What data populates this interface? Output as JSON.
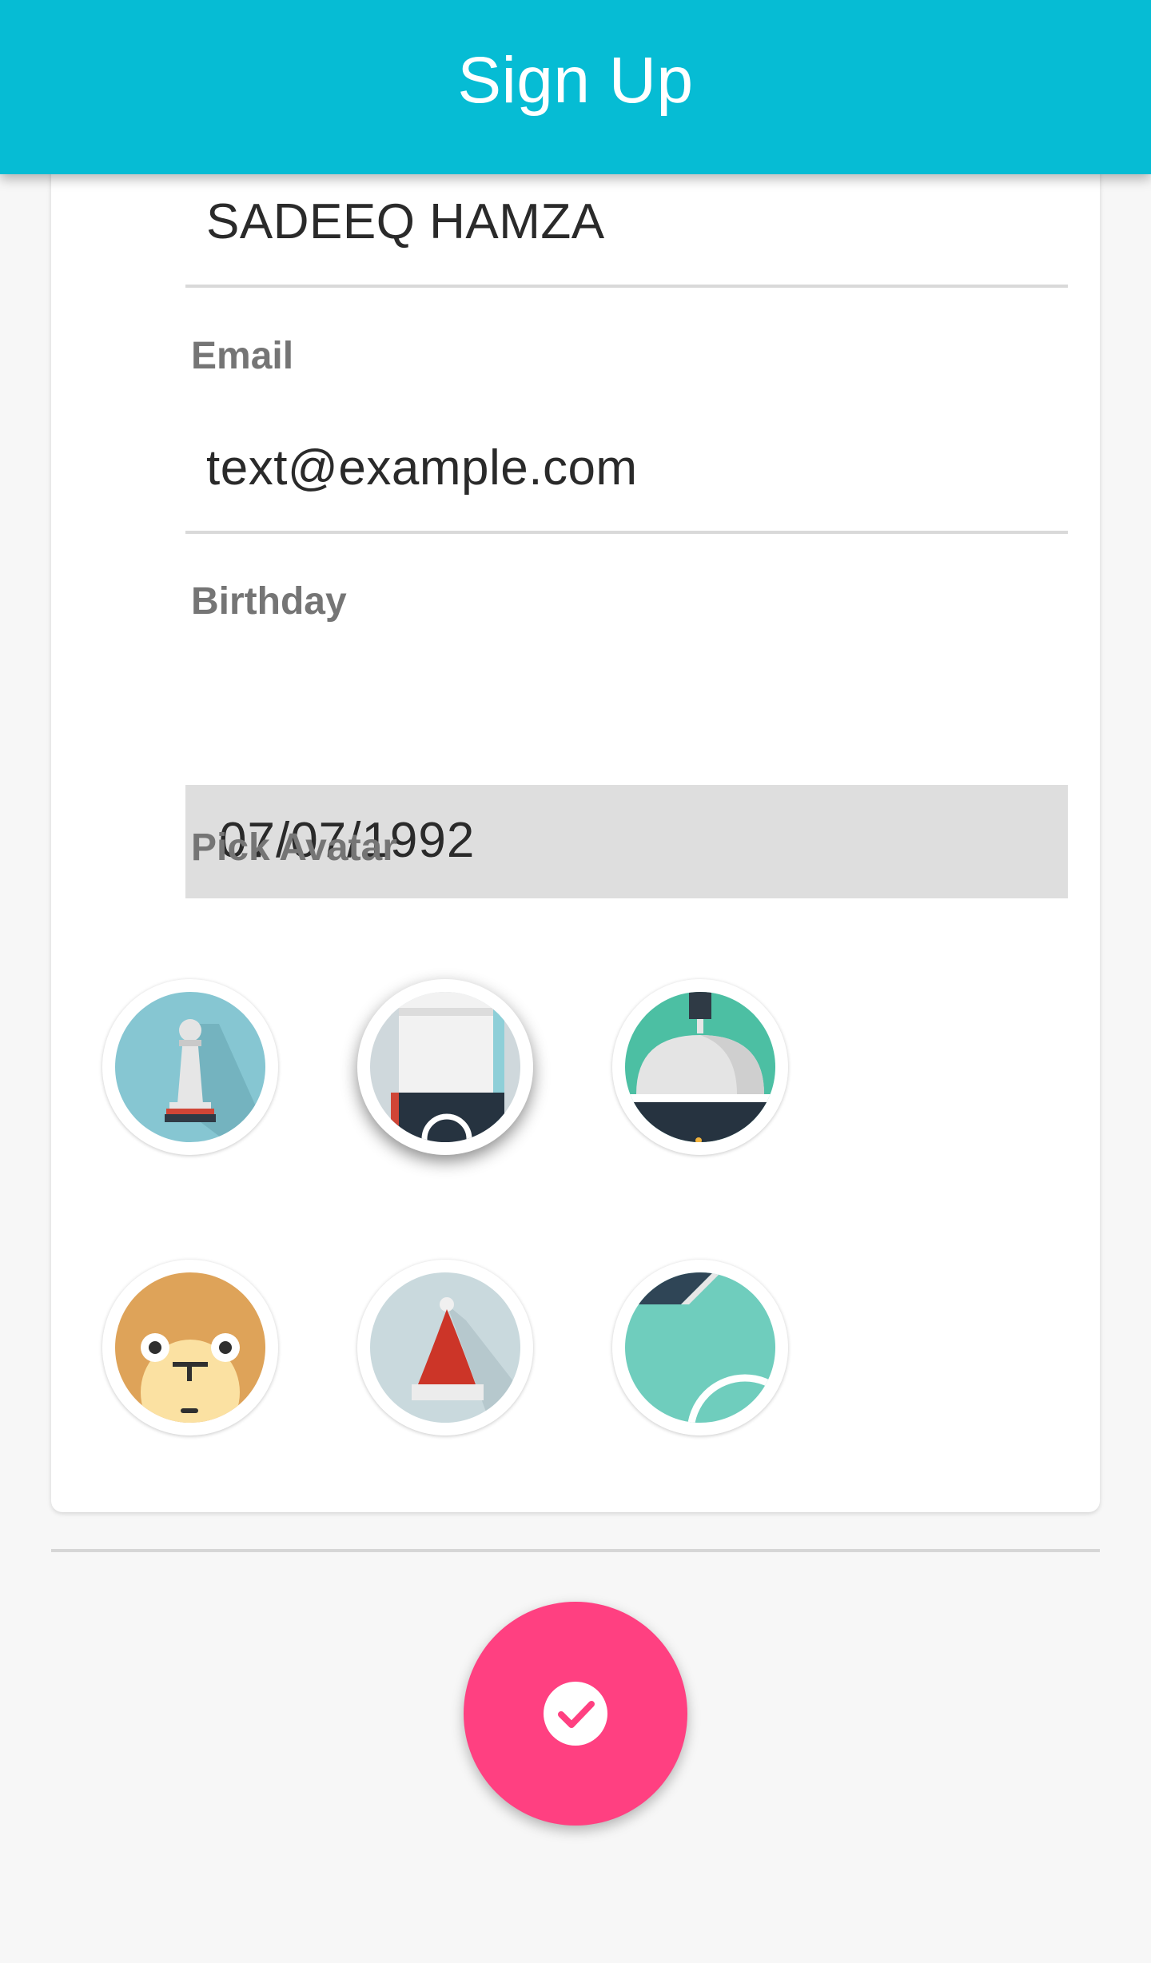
{
  "app_bar": {
    "title": "Sign Up",
    "color": "#06bcd4"
  },
  "form": {
    "name": {
      "value": "SADEEQ HAMZA"
    },
    "email": {
      "label": "Email",
      "value": "text@example.com"
    },
    "birthday": {
      "label": "Birthday",
      "value": "07/07/1992"
    },
    "avatar_picker": {
      "label": "Pick Avatar",
      "avatars": [
        {
          "icon": "chess-pawn-icon",
          "selected": false
        },
        {
          "icon": "phone-icon",
          "selected": true
        },
        {
          "icon": "cloche-icon",
          "selected": false
        },
        {
          "icon": "monkey-icon",
          "selected": false
        },
        {
          "icon": "santa-hat-icon",
          "selected": false
        },
        {
          "icon": "tennis-ball-icon",
          "selected": false
        }
      ]
    }
  },
  "fab": {
    "icon": "check-circle-icon",
    "color": "#ff4081"
  }
}
